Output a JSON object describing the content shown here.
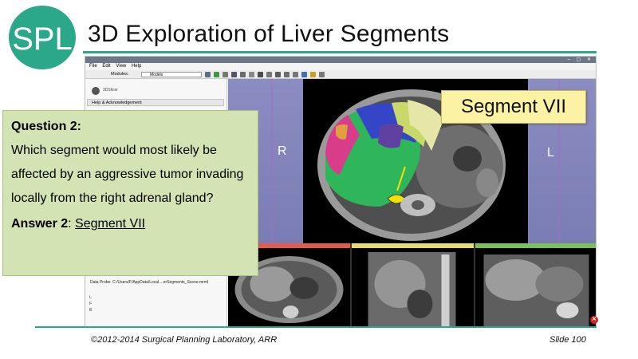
{
  "logo": {
    "text": "SPL",
    "color": "#2aa889"
  },
  "slide": {
    "title": "3D Exploration of Liver Segments",
    "copyright": "©2012-2014 Surgical Planning Laboratory, ARR",
    "slide_number": "Slide 100",
    "accent": "#2aa889"
  },
  "app": {
    "menu": [
      "File",
      "Edit",
      "View",
      "Help"
    ],
    "modules_label": "Modules:",
    "module_selected": "Models",
    "brand_text": "3DSlicer",
    "help_row": "Help & Acknowledgement",
    "data_probe": "Data Probe: C:/Users/F/AppData/Local....erSegments_Scene.mrml",
    "probe_lines": [
      "L",
      "F",
      "B"
    ],
    "view_labels": {
      "right": "R",
      "left": "L"
    }
  },
  "callout": {
    "text": "Segment VII"
  },
  "question": {
    "title": "Question 2:",
    "text": "Which segment would most likely be affected by an aggressive tumor invading locally from the right adrenal gland?",
    "answer_label": "Answer 2",
    "answer_sep": ": ",
    "answer_value": "Segment VII"
  }
}
